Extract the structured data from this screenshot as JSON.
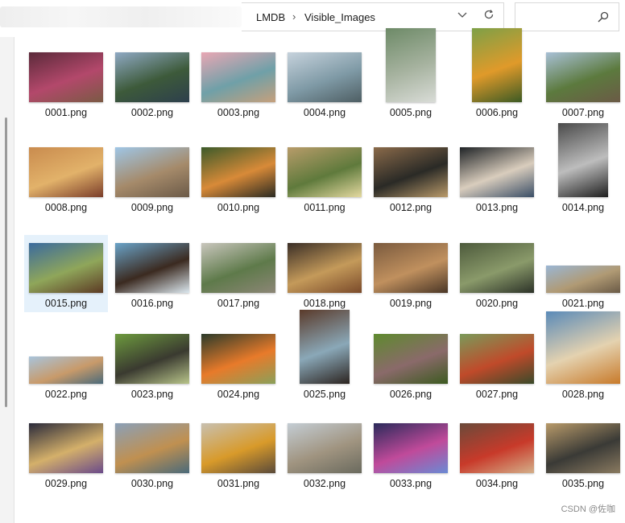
{
  "addressbar": {
    "crumbs": [
      "LMDB",
      "Visible_Images"
    ],
    "separator": "›",
    "dropdown_icon": "chevron-down-icon",
    "refresh_icon": "refresh-icon"
  },
  "search": {
    "placeholder": "",
    "icon": "search-icon"
  },
  "files": [
    {
      "name": "0001.png",
      "shape": "land",
      "colors": [
        "#5b2a3a",
        "#b3486b",
        "#7a5a44"
      ]
    },
    {
      "name": "0002.png",
      "shape": "land",
      "colors": [
        "#8fa9c4",
        "#3d5a3a",
        "#2d3f4d"
      ]
    },
    {
      "name": "0003.png",
      "shape": "land",
      "colors": [
        "#e9a7b4",
        "#6fa0a8",
        "#c6a07c"
      ]
    },
    {
      "name": "0004.png",
      "shape": "land",
      "colors": [
        "#c6d2dc",
        "#7f9aa6",
        "#4e5e63"
      ]
    },
    {
      "name": "0005.png",
      "shape": "port",
      "colors": [
        "#6d8a67",
        "#a7b3a0",
        "#d9dcd7"
      ]
    },
    {
      "name": "0006.png",
      "shape": "port",
      "colors": [
        "#7da047",
        "#e09a2a",
        "#3c5a24"
      ]
    },
    {
      "name": "0007.png",
      "shape": "land",
      "colors": [
        "#a8c0d6",
        "#5c7a3e",
        "#6b5a46"
      ]
    },
    {
      "name": "0008.png",
      "shape": "land",
      "colors": [
        "#c98b4e",
        "#e2b26a",
        "#7a3d2a"
      ]
    },
    {
      "name": "0009.png",
      "shape": "land",
      "colors": [
        "#9fc6e6",
        "#a58a6a",
        "#6b5a48"
      ]
    },
    {
      "name": "0010.png",
      "shape": "land",
      "colors": [
        "#3c5a2a",
        "#d88a38",
        "#2a2a22"
      ]
    },
    {
      "name": "0011.png",
      "shape": "land",
      "colors": [
        "#b89c6a",
        "#5f7a3c",
        "#e4d9a0"
      ]
    },
    {
      "name": "0012.png",
      "shape": "land",
      "colors": [
        "#8a6a4a",
        "#2a2a26",
        "#b99a6a"
      ]
    },
    {
      "name": "0013.png",
      "shape": "land",
      "colors": [
        "#1f2326",
        "#d9cdbd",
        "#3a4e66"
      ]
    },
    {
      "name": "0014.png",
      "shape": "port",
      "colors": [
        "#4a4a4a",
        "#bdbdbd",
        "#1e1e1e"
      ]
    },
    {
      "name": "0015.png",
      "shape": "land",
      "colors": [
        "#3a6a9e",
        "#8fa65a",
        "#5c3a24"
      ]
    },
    {
      "name": "0016.png",
      "shape": "land",
      "colors": [
        "#6aa3c8",
        "#3b2a20",
        "#dce8ef"
      ]
    },
    {
      "name": "0017.png",
      "shape": "land",
      "colors": [
        "#c9c6bd",
        "#5e7a4a",
        "#8c8676"
      ]
    },
    {
      "name": "0018.png",
      "shape": "land",
      "colors": [
        "#3a2e26",
        "#c49a5a",
        "#7a4a2a"
      ]
    },
    {
      "name": "0019.png",
      "shape": "land",
      "colors": [
        "#7a5a3e",
        "#c0905e",
        "#4a3626"
      ]
    },
    {
      "name": "0020.png",
      "shape": "land",
      "colors": [
        "#4d5a3c",
        "#8a9a6a",
        "#2c3228"
      ]
    },
    {
      "name": "0021.png",
      "shape": "wide",
      "colors": [
        "#9ab6d4",
        "#b09a74",
        "#6a5a46"
      ]
    },
    {
      "name": "0022.png",
      "shape": "wide",
      "colors": [
        "#a8c4dc",
        "#c89a6a",
        "#4a6a7a"
      ]
    },
    {
      "name": "0023.png",
      "shape": "land",
      "colors": [
        "#6d9a3e",
        "#3a3a30",
        "#b8c48a"
      ]
    },
    {
      "name": "0024.png",
      "shape": "land",
      "colors": [
        "#2a3a2a",
        "#e87a2a",
        "#8aa05a"
      ]
    },
    {
      "name": "0025.png",
      "shape": "port",
      "colors": [
        "#5a3a2a",
        "#8aa8b8",
        "#2c2420"
      ]
    },
    {
      "name": "0026.png",
      "shape": "land",
      "colors": [
        "#5e8a2e",
        "#8a6a6a",
        "#3c5a20"
      ]
    },
    {
      "name": "0027.png",
      "shape": "land",
      "colors": [
        "#7a9a5a",
        "#c04a2a",
        "#3a4a2a"
      ]
    },
    {
      "name": "0028.png",
      "shape": "square",
      "colors": [
        "#5a8ab8",
        "#e4d2b0",
        "#c87a2a"
      ]
    },
    {
      "name": "0029.png",
      "shape": "land",
      "colors": [
        "#2a2a3a",
        "#d4b06a",
        "#6a4a8a"
      ]
    },
    {
      "name": "0030.png",
      "shape": "land",
      "colors": [
        "#8aa0b8",
        "#c09050",
        "#4a6a7a"
      ]
    },
    {
      "name": "0031.png",
      "shape": "land",
      "colors": [
        "#c8c0b0",
        "#d89a2a",
        "#5a4a3a"
      ]
    },
    {
      "name": "0032.png",
      "shape": "land",
      "colors": [
        "#c4cdd4",
        "#a09480",
        "#6a6a5e"
      ]
    },
    {
      "name": "0033.png",
      "shape": "land",
      "colors": [
        "#2a2a5a",
        "#c04a9a",
        "#6a8ad4"
      ]
    },
    {
      "name": "0034.png",
      "shape": "land",
      "colors": [
        "#6a4a3a",
        "#c83a2a",
        "#d4b08a"
      ]
    },
    {
      "name": "0035.png",
      "shape": "land",
      "colors": [
        "#b89a6a",
        "#3a3a36",
        "#8a7a60"
      ]
    }
  ],
  "selected_index": 14,
  "watermark": "CSDN @佐咖"
}
